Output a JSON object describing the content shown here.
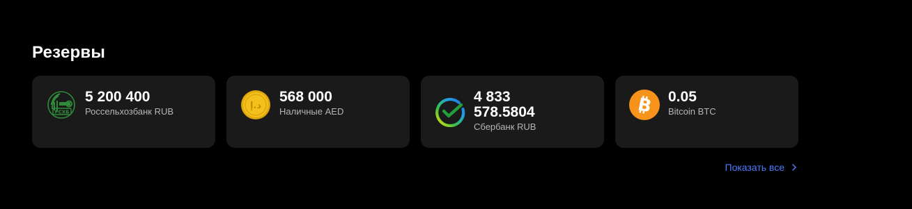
{
  "reserves": {
    "title": "Резервы",
    "cards": [
      {
        "amount": "5 200 400",
        "label": "Россельхозбанк RUB",
        "icon": "rosselkhozbank-logo-icon"
      },
      {
        "amount": "568 000",
        "label": "Наличные AED",
        "icon": "aed-coin-icon"
      },
      {
        "amount": "4 833 578.5804",
        "label": "Сбербанк RUB",
        "icon": "sberbank-logo-icon"
      },
      {
        "amount": "0.05",
        "label": "Bitcoin BTC",
        "icon": "bitcoin-icon"
      }
    ],
    "show_all": "Показать все",
    "show_all_icon": "chevron-right-icon"
  },
  "colors": {
    "background": "#000000",
    "card": "#1a1a1a",
    "link": "#4d7cff",
    "rshb_green": "#2e8b3a",
    "sber_green": "#21a038",
    "bitcoin_orange": "#f7931a",
    "coin_gold": "#f2c11b"
  }
}
